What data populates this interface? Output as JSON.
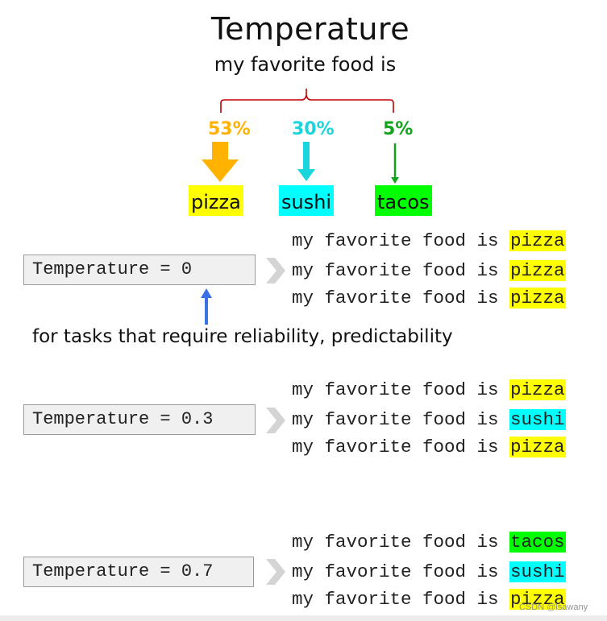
{
  "header": {
    "title": "Temperature",
    "subtitle": "my favorite food is"
  },
  "colors": {
    "pizza": "#ffff00",
    "sushi": "#00ffff",
    "tacos": "#00ff00",
    "pizza_arrow": "#ffb300",
    "sushi_arrow": "#1ad6dc",
    "tacos_arrow": "#12a41a",
    "brace": "#c00000",
    "pointer_arrow": "#3b6fe6"
  },
  "probabilities": [
    {
      "food": "pizza",
      "percent": "53%",
      "value": 53
    },
    {
      "food": "sushi",
      "percent": "30%",
      "value": 30
    },
    {
      "food": "tacos",
      "percent": "5%",
      "value": 5
    }
  ],
  "examples": [
    {
      "setting": "Temperature = 0",
      "outputs": [
        {
          "prefix": "my favorite food is ",
          "food": "pizza"
        },
        {
          "prefix": "my favorite food is ",
          "food": "pizza"
        },
        {
          "prefix": "my favorite food is ",
          "food": "pizza"
        }
      ]
    },
    {
      "setting": "Temperature = 0.3",
      "outputs": [
        {
          "prefix": "my favorite food is ",
          "food": "pizza"
        },
        {
          "prefix": "my favorite food is ",
          "food": "sushi"
        },
        {
          "prefix": "my favorite food is ",
          "food": "pizza"
        }
      ]
    },
    {
      "setting": "Temperature = 0.7",
      "outputs": [
        {
          "prefix": "my favorite food is ",
          "food": "tacos"
        },
        {
          "prefix": "my favorite food is ",
          "food": "sushi"
        },
        {
          "prefix": "my favorite food is ",
          "food": "pizza"
        }
      ]
    }
  ],
  "note": "for tasks that require reliability, predictability",
  "watermark": "CSDN @lsawany"
}
